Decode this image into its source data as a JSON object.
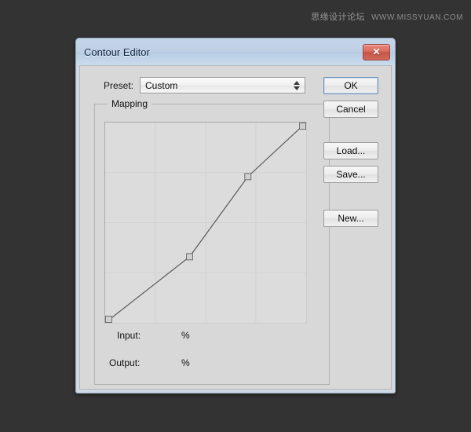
{
  "watermark": {
    "cn_text": "思缘设计论坛",
    "url_text": "WWW.MISSYUAN.COM"
  },
  "dialog": {
    "title": "Contour Editor",
    "close_glyph": "✕",
    "close_icon_name": "close-icon"
  },
  "preset": {
    "label": "Preset:",
    "value": "Custom",
    "options": [
      "Custom"
    ]
  },
  "mapping": {
    "legend": "Mapping",
    "input": {
      "label": "Input:",
      "value": "",
      "unit": "%"
    },
    "output": {
      "label": "Output:",
      "value": "",
      "unit": "%"
    }
  },
  "buttons": {
    "ok": "OK",
    "cancel": "Cancel",
    "load": "Load...",
    "save": "Save...",
    "new": "New..."
  },
  "chart_data": {
    "type": "line",
    "title": "Mapping",
    "xlabel": "Input",
    "ylabel": "Output",
    "xlim": [
      0,
      100
    ],
    "ylim": [
      0,
      100
    ],
    "grid": true,
    "grid_divisions": 4,
    "x": [
      0,
      42,
      71,
      100
    ],
    "y": [
      0,
      33,
      73,
      100
    ],
    "points": [
      {
        "input": 0,
        "output": 0
      },
      {
        "input": 42,
        "output": 33
      },
      {
        "input": 71,
        "output": 73
      },
      {
        "input": 100,
        "output": 100
      }
    ],
    "line_color": "#5a5a5a",
    "point_fill": "#d0d0d0",
    "point_stroke": "#6e6e6e",
    "plot_background": "#dcdcdc",
    "grid_color": "#d2d2d2"
  }
}
